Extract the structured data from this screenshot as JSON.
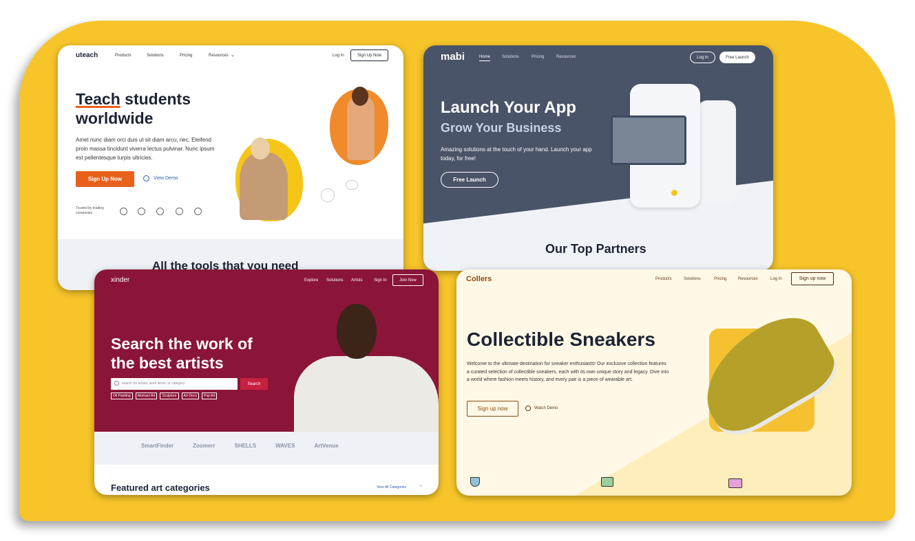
{
  "uteach": {
    "logo": "uteach",
    "nav": [
      "Products",
      "Solutions",
      "Pricing",
      "Resources"
    ],
    "login": "Log In",
    "signup": "Sign Up Now",
    "headline_highlight": "Teach",
    "headline_rest": "students",
    "headline_line2": "worldwide",
    "body": "Amet nunc diam orci duis ut sit diam arcu, nec. Eleifend proin massa tincidunt viverra lectus pulvinar. Nunc ipsum est pellentesque turpis ultricies.",
    "cta": "Sign Up Now",
    "demo": "View Demo",
    "trusted": "Trusted by leading companies",
    "section_title": "All the tools that you need",
    "colors": {
      "accent": "#e8601c",
      "text": "#1c2434"
    }
  },
  "mabi": {
    "logo": "mabi",
    "nav": [
      "Home",
      "Solutions",
      "Pricing",
      "Resources"
    ],
    "login": "Log In",
    "free_launch_nav": "Free Launch",
    "headline": "Launch Your App",
    "subheadline": "Grow Your Business",
    "body": "Amazing solutions at the touch of your hand. Launch your app today, for free!",
    "cta": "Free Launch",
    "partners": "Our Top Partners",
    "colors": {
      "bg": "#4a5468"
    }
  },
  "xinder": {
    "logo": "xinder",
    "nav": [
      "Explore",
      "Solutions",
      "Artists",
      "Sign In"
    ],
    "join": "Join Now",
    "headline_line1": "Search the work of",
    "headline_line2": "the best artists",
    "search_placeholder": "search for artists, work items, or category",
    "search_button": "Search",
    "tags": [
      "Oil Painting",
      "Abstract Art",
      "Sculpture",
      "Art Deco",
      "Pop Art"
    ],
    "partners": [
      "SmartFinder",
      "Zoomerr",
      "SHELLS",
      "WAVES",
      "ArtVenue"
    ],
    "section_title": "Featured art categories",
    "view_all": "View All Categories",
    "colors": {
      "bg": "#8a1538",
      "button": "#c8203f"
    }
  },
  "collers": {
    "logo": "Collers",
    "nav": [
      "Products",
      "Solutions",
      "Pricing",
      "Resources",
      "Log In"
    ],
    "signup_nav": "Sign up now",
    "headline": "Collectible Sneakers",
    "body": "Welcome to the ultimate destination for sneaker enthusiasts! Our exclusive collection features a curated selection of collectible sneakers, each with its own unique story and legacy. Dive into a world where fashion meets history, and every pair is a piece of wearable art.",
    "cta": "Sign up now",
    "demo": "Watch Demo",
    "colors": {
      "brand": "#8a4a10",
      "box": "#f5c130"
    }
  }
}
